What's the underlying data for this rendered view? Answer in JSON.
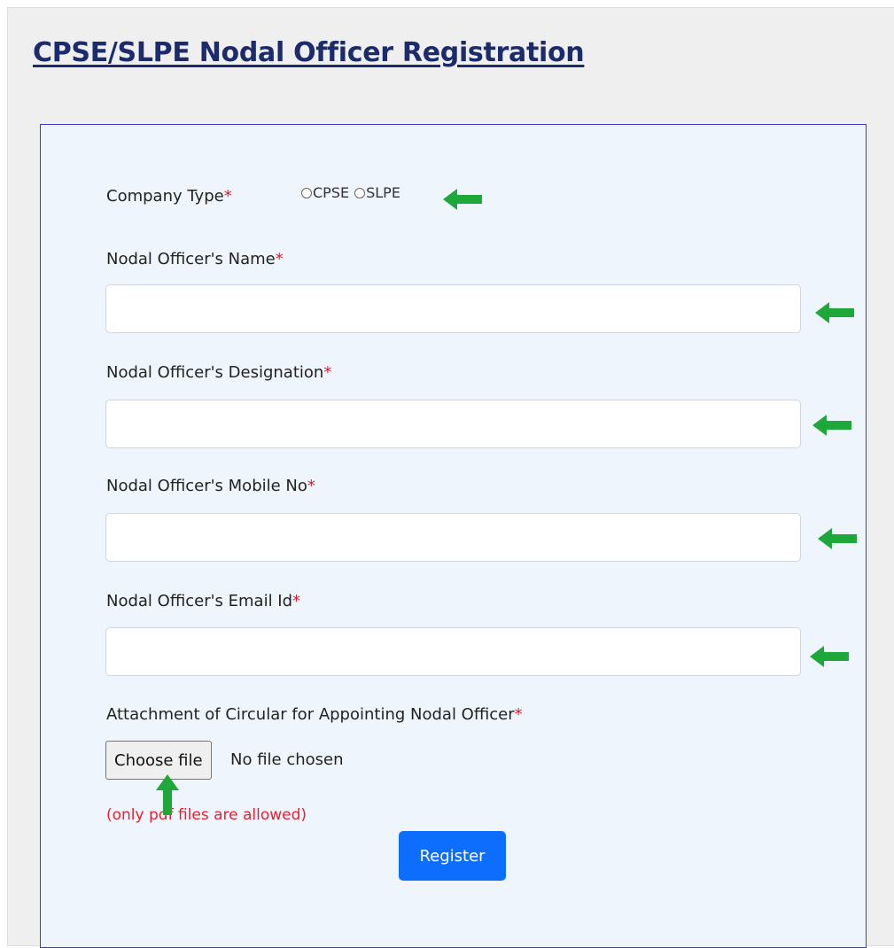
{
  "header": {
    "title": "CPSE/SLPE Nodal Officer Registration"
  },
  "form": {
    "company_type": {
      "label": "Company Type",
      "required_mark": "*",
      "options": [
        "CPSE",
        "SLPE"
      ]
    },
    "name": {
      "label": "Nodal Officer's Name",
      "required_mark": "*",
      "value": ""
    },
    "designation": {
      "label": "Nodal Officer's Designation",
      "required_mark": "*",
      "value": ""
    },
    "mobile": {
      "label": "Nodal Officer's Mobile No",
      "required_mark": "*",
      "value": ""
    },
    "email": {
      "label": "Nodal Officer's Email Id",
      "required_mark": "*",
      "value": ""
    },
    "attachment": {
      "label": "Attachment of Circular for Appointing Nodal Officer",
      "required_mark": "*",
      "button_label": "Choose file",
      "status": "No file chosen",
      "hint": "(only pdf files are allowed)"
    },
    "register_label": "Register"
  },
  "annotation_arrows": {
    "color": "#1fa83a"
  },
  "colors": {
    "accent": "#0d6efd",
    "required": "#e0182a",
    "title": "#1b2b6b"
  }
}
